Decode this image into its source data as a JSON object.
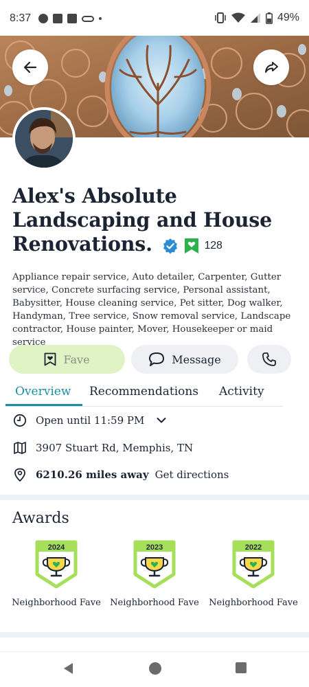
{
  "status_bar": {
    "time": "8:37",
    "battery": "49%",
    "left_icons": [
      "chat-bubble-icon",
      "facebook-icon",
      "facebook-icon",
      "voicemail-icon",
      "dot-icon"
    ],
    "right_icons": [
      "vibrate-icon",
      "wifi-icon",
      "signal-icon",
      "battery-icon"
    ]
  },
  "business": {
    "name": "Alex's Absolute Landscaping and House Renovations.",
    "fave_count": "128",
    "services": [
      "Appliance repair service,",
      "Auto detailer,",
      "Carpenter,",
      "Gutter service,",
      "Concrete surfacing service,",
      "Personal assistant,",
      "Babysitter,",
      "House cleaning service,",
      "Pet sitter,",
      "Dog walker,",
      "Handyman,",
      "Tree service,",
      "Snow removal service,",
      "Landscape contractor,",
      "House painter,",
      "Mover,",
      "Housekeeper or maid service"
    ]
  },
  "actions": {
    "fave_label": "Fave",
    "message_label": "Message"
  },
  "tabs": [
    "Overview",
    "Recommendations",
    "Activity"
  ],
  "active_tab": "Overview",
  "info": {
    "hours": "Open until 11:59 PM",
    "address": "3907 Stuart Rd, Memphis, TN",
    "distance": "6210.26 miles away",
    "directions_label": "Get directions"
  },
  "awards": {
    "title": "Awards",
    "items": [
      {
        "year": "2024",
        "label": "Neighborhood Fave"
      },
      {
        "year": "2023",
        "label": "Neighborhood Fave"
      },
      {
        "year": "2022",
        "label": "Neighborhood Fave"
      }
    ]
  },
  "colors": {
    "accent": "#1890a0",
    "fave_green": "#2bb24c",
    "fave_bg": "#dff3c4",
    "badge_green": "#a6e05a",
    "verified_blue": "#2a8bd6"
  }
}
